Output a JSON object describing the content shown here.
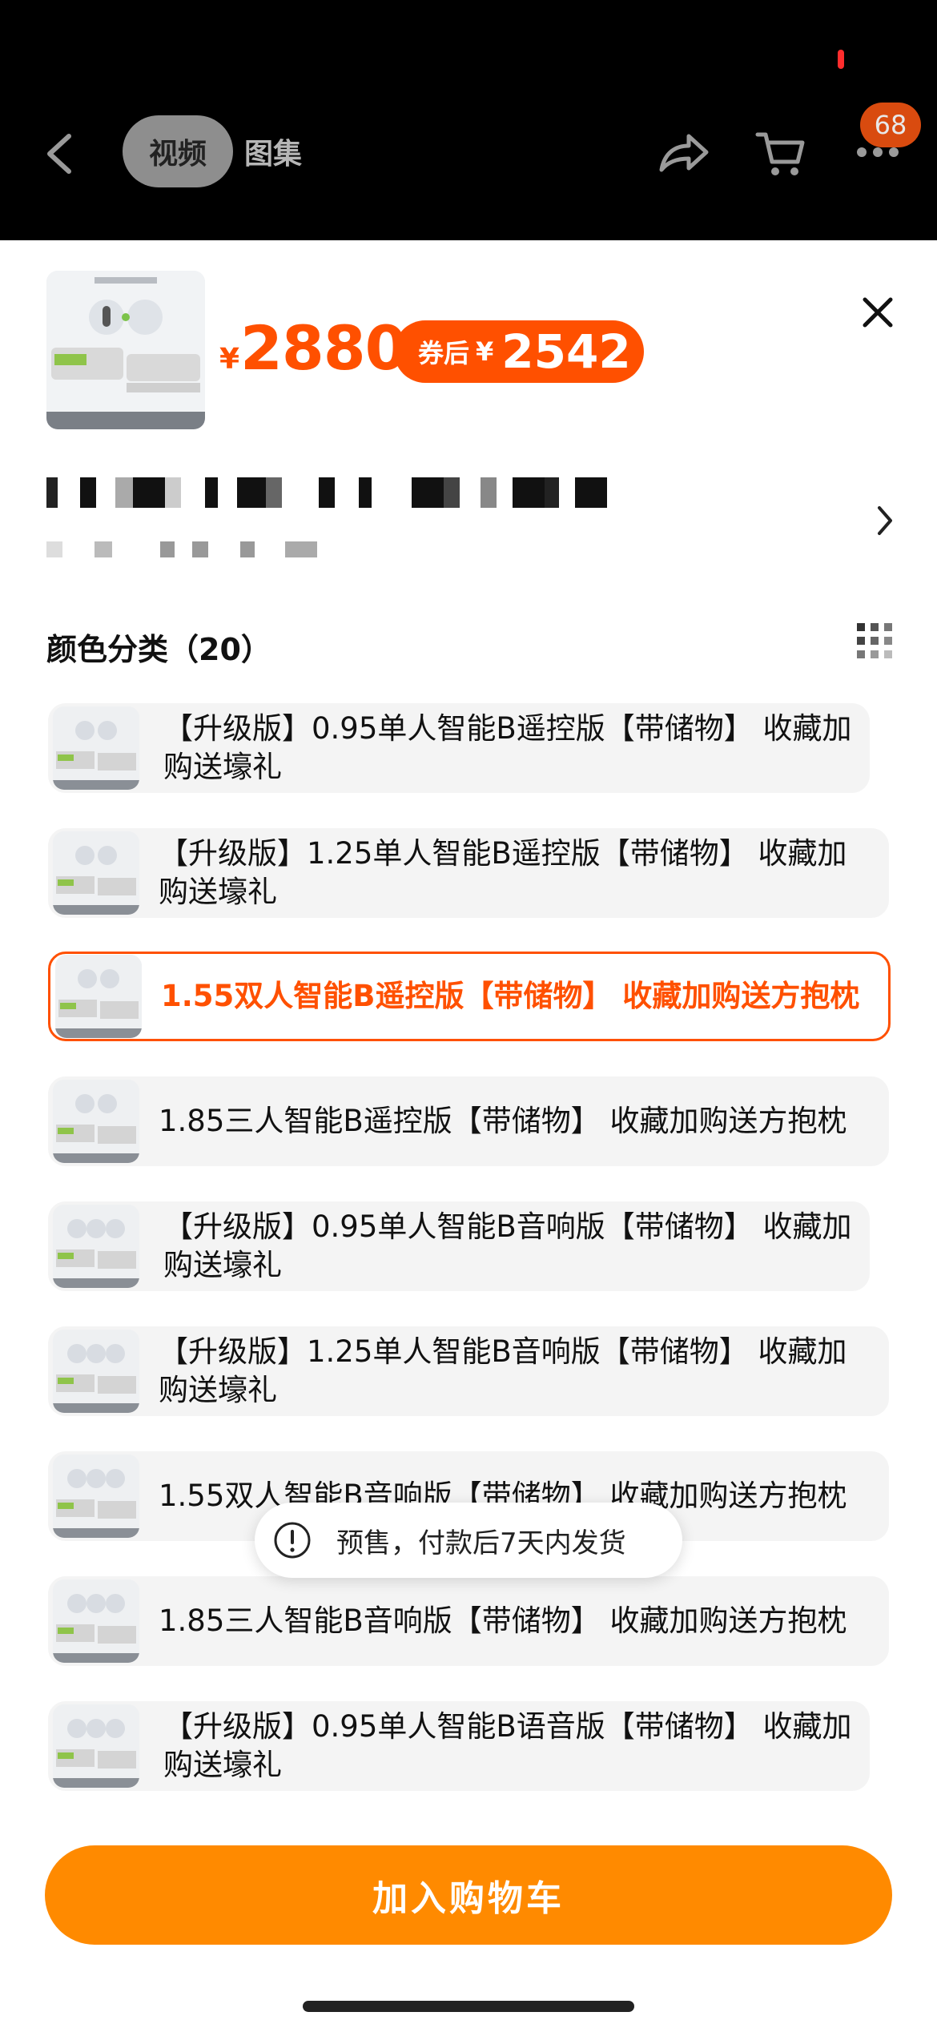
{
  "header": {
    "tabs": [
      {
        "label": "视频",
        "active": true
      },
      {
        "label": "图集",
        "active": false
      }
    ],
    "cart_badge": "68",
    "icons": [
      "back-icon",
      "share-icon",
      "cart-icon",
      "more-icon"
    ]
  },
  "product": {
    "price_currency": "¥",
    "price": "2880",
    "coupon_label": "券后",
    "coupon_currency": "¥",
    "coupon_price": "2542"
  },
  "section": {
    "title": "颜色分类（20）"
  },
  "options": [
    {
      "label": "【升级版】0.95单人智能B遥控版【带储物】 收藏加购送壕礼",
      "selected": false
    },
    {
      "label": "【升级版】1.25单人智能B遥控版【带储物】 收藏加购送壕礼",
      "selected": false
    },
    {
      "label": "1.55双人智能B遥控版【带储物】 收藏加购送方抱枕",
      "selected": true
    },
    {
      "label": "1.85三人智能B遥控版【带储物】 收藏加购送方抱枕",
      "selected": false
    },
    {
      "label": "【升级版】0.95单人智能B音响版【带储物】 收藏加购送壕礼",
      "selected": false
    },
    {
      "label": "【升级版】1.25单人智能B音响版【带储物】 收藏加购送壕礼",
      "selected": false
    },
    {
      "label": "1.55双人智能B音响版【带储物】 收藏加购送方抱枕",
      "selected": false
    },
    {
      "label": "1.85三人智能B音响版【带储物】 收藏加购送方抱枕",
      "selected": false
    },
    {
      "label": "【升级版】0.95单人智能B语音版【带储物】 收藏加购送壕礼",
      "selected": false
    }
  ],
  "toast": {
    "message": "预售，付款后7天内发货"
  },
  "footer": {
    "add_to_cart": "加入购物车"
  },
  "colors": {
    "accent": "#ff5000",
    "cart_button": "#ff8a00",
    "badge": "#d94b0f"
  }
}
